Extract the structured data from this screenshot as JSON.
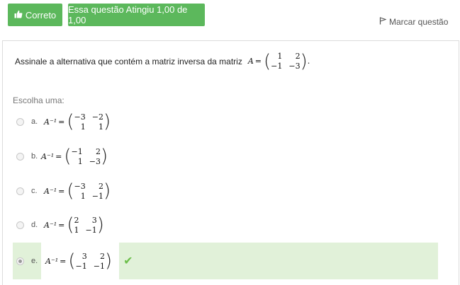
{
  "header": {
    "status_label": "Correto",
    "grade_label": "Essa questão Atingiu 1,00 de 1,00",
    "flag_label": "Marcar questão"
  },
  "question": {
    "text": "Assinale a alternativa que contém a matriz inversa da matriz",
    "matrix_label": "A",
    "matrix": [
      [
        "1",
        "2"
      ],
      [
        "−1",
        "−3"
      ]
    ],
    "suffix": "."
  },
  "choose_label": "Escolha uma:",
  "options": [
    {
      "letter": "a.",
      "lhs": "A⁻¹",
      "matrix": [
        [
          "−3",
          "−2"
        ],
        [
          "1",
          "1"
        ]
      ],
      "selected": false
    },
    {
      "letter": "b.",
      "lhs": "A⁻¹",
      "matrix": [
        [
          "−1",
          "2"
        ],
        [
          "1",
          "−3"
        ]
      ],
      "selected": false
    },
    {
      "letter": "c.",
      "lhs": "A⁻¹",
      "matrix": [
        [
          "−3",
          "2"
        ],
        [
          "1",
          "−1"
        ]
      ],
      "selected": false
    },
    {
      "letter": "d.",
      "lhs": "A⁻¹",
      "matrix": [
        [
          "2",
          "3"
        ],
        [
          "1",
          "−1"
        ]
      ],
      "selected": false
    },
    {
      "letter": "e.",
      "lhs": "A⁻¹",
      "matrix": [
        [
          "3",
          "2"
        ],
        [
          "−1",
          "−1"
        ]
      ],
      "selected": true
    }
  ],
  "colors": {
    "accent": "#5cb85c",
    "correct_bg": "#e1f1d9",
    "check": "#6cbf4a"
  },
  "icons": {
    "status": "thumbs-up-icon",
    "flag": "flag-icon",
    "correct": "checkmark-icon"
  }
}
